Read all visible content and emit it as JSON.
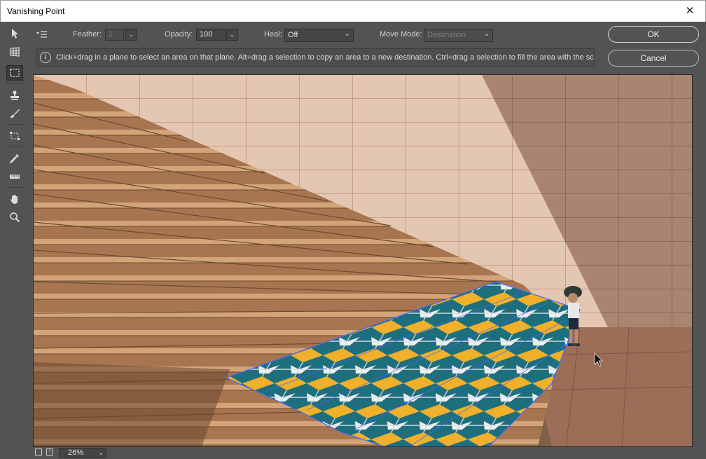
{
  "window": {
    "title": "Vanishing Point",
    "close_glyph": "✕"
  },
  "tools": [
    {
      "name": "edit-plane-tool-icon"
    },
    {
      "name": "create-plane-tool-icon"
    },
    {
      "name": "marquee-tool-icon"
    },
    {
      "name": "stamp-tool-icon"
    },
    {
      "name": "brush-tool-icon"
    },
    {
      "name": "transform-tool-icon"
    },
    {
      "name": "eyedropper-tool-icon"
    },
    {
      "name": "measure-tool-icon"
    },
    {
      "name": "hand-tool-icon"
    },
    {
      "name": "zoom-tool-icon"
    }
  ],
  "options": {
    "menu_icon": "options-menu-icon",
    "feather_label": "Feather:",
    "feather_value": "1",
    "opacity_label": "Opacity:",
    "opacity_value": "100",
    "heal_label": "Heal:",
    "heal_value": "Off",
    "move_mode_label": "Move Mode:",
    "move_mode_value": "Destination"
  },
  "info": {
    "icon": "info-icon",
    "icon_glyph": "i",
    "message": "Click+drag in a plane to select an area on that plane. Alt+drag a selection to copy an area to a new destination. Ctrl+drag a selection to fill the area with the sc"
  },
  "buttons": {
    "ok": "OK",
    "cancel": "Cancel"
  },
  "status": {
    "zoom": "26%"
  },
  "colors": {
    "panel": "#535353",
    "tile_teal": "#1d6f7e",
    "tile_yellow": "#f0b02a",
    "plane_outline": "#4a63ff"
  }
}
